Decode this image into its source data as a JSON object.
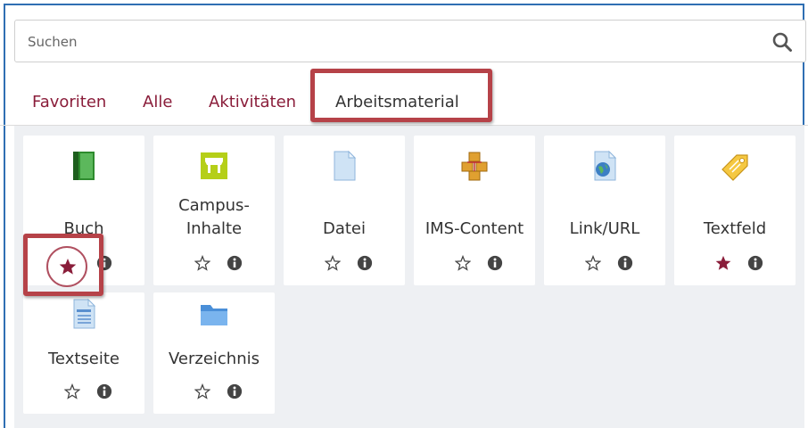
{
  "search": {
    "placeholder": "Suchen",
    "icon": "search-icon"
  },
  "tabs": [
    {
      "label": "Favoriten"
    },
    {
      "label": "Alle"
    },
    {
      "label": "Aktivitäten"
    },
    {
      "label": "Arbeitsmaterial",
      "active": true
    }
  ],
  "colors": {
    "accent": "#8a1d3a",
    "highlight": "#b64248",
    "frame": "#2f6fb3",
    "grid_bg": "#eef0f3"
  },
  "modules": [
    {
      "label": "Buch",
      "icon": "book-icon",
      "starred": true
    },
    {
      "label_line1": "Campus-",
      "label_line2": "Inhalte",
      "icon": "campus-content-icon",
      "starred": false
    },
    {
      "label": "Datei",
      "icon": "file-icon",
      "starred": false
    },
    {
      "label": "IMS-Content",
      "icon": "ims-package-icon",
      "starred": false
    },
    {
      "label": "Link/URL",
      "icon": "url-icon",
      "starred": false
    },
    {
      "label": "Textfeld",
      "icon": "label-tag-icon",
      "starred": true
    },
    {
      "label": "Textseite",
      "icon": "page-icon",
      "starred": false
    },
    {
      "label": "Verzeichnis",
      "icon": "folder-icon",
      "starred": false
    }
  ]
}
